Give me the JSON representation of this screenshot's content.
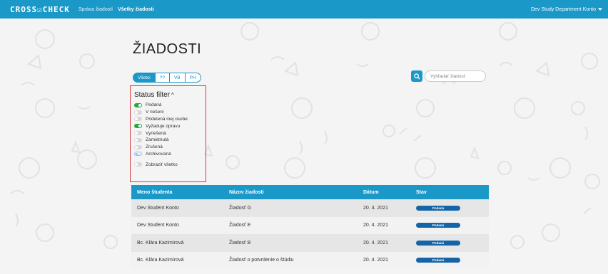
{
  "navbar": {
    "logo": "CROSS☑CHECK",
    "links": [
      "Správa žiadostí",
      "Všetky žiadosti"
    ],
    "account": "Dev Study Department Konto",
    "color": "#1a98c8"
  },
  "page_title": "ŽIADOSTI",
  "type_filter": [
    "Všetci",
    "??",
    "VB",
    "PH"
  ],
  "search": {
    "placeholder": "Vyhľadať žiadosť",
    "icon": "search-icon"
  },
  "status_filter": {
    "title": "Status filter",
    "items": [
      {
        "label": "Podaná",
        "on": true
      },
      {
        "label": "V riešení",
        "on": false
      },
      {
        "label": "Pridelená inej osobe",
        "on": false
      },
      {
        "label": "Vyžaduje úpravu",
        "on": true
      },
      {
        "label": "Vyriešená",
        "on": false
      },
      {
        "label": "Zamietnutá",
        "on": false
      },
      {
        "label": "Zrušená",
        "on": false
      },
      {
        "label": "Archivovaná",
        "on": false
      }
    ],
    "show_all": "Zobraziť všetko"
  },
  "table": {
    "headers": [
      "Meno študenta",
      "Názov žiadosti",
      "Dátum",
      "Stav"
    ],
    "rows": [
      {
        "student": "Dev Student Konto",
        "name": "Žiadosť G",
        "date": "20. 4. 2021",
        "status": "Podaná"
      },
      {
        "student": "Dev Student Konto",
        "name": "Žiadosť E",
        "date": "20. 4. 2021",
        "status": "Podaná"
      },
      {
        "student": "Bc. Klára Kazimírová",
        "name": "Žiadosť B",
        "date": "20. 4. 2021",
        "status": "Podaná"
      },
      {
        "student": "Bc. Klára Kazimírová",
        "name": "Žiadosť o potvrdenie o štúdiu",
        "date": "20. 4. 2021",
        "status": "Podaná"
      }
    ]
  }
}
